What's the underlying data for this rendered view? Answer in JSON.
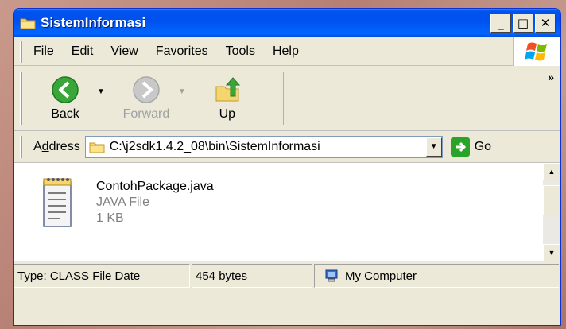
{
  "window": {
    "title": "SistemInformasi",
    "controls": {
      "minimize": "_",
      "maximize": "□",
      "close": "✕"
    }
  },
  "menubar": {
    "items": [
      {
        "label": "File",
        "mnemonic": "F",
        "rest": "ile"
      },
      {
        "label": "Edit",
        "mnemonic": "E",
        "rest": "dit"
      },
      {
        "label": "View",
        "mnemonic": "V",
        "rest": "iew"
      },
      {
        "label": "Favorites",
        "pre": "F",
        "mnemonic": "a",
        "rest": "vorites"
      },
      {
        "label": "Tools",
        "mnemonic": "T",
        "rest": "ools"
      },
      {
        "label": "Help",
        "mnemonic": "H",
        "rest": "elp"
      }
    ]
  },
  "toolbar": {
    "back_label": "Back",
    "forward_label": "Forward",
    "up_label": "Up",
    "more": "»"
  },
  "address": {
    "label_pre": "A",
    "label_mnemonic": "d",
    "label_rest": "dress",
    "path": "C:\\j2sdk1.4.2_08\\bin\\SistemInformasi",
    "go_label": "Go"
  },
  "content": {
    "files": [
      {
        "name": "ContohPackage.java",
        "type": "JAVA File",
        "size": "1 KB",
        "icon": "notepad-file-icon"
      }
    ]
  },
  "statusbar": {
    "type_text": "Type: CLASS File Date",
    "size_text": "454 bytes",
    "zone_text": "My Computer"
  },
  "colors": {
    "titlebar": "#0054e3",
    "window_bg": "#ece9d8",
    "go_green": "#2aa32a"
  }
}
